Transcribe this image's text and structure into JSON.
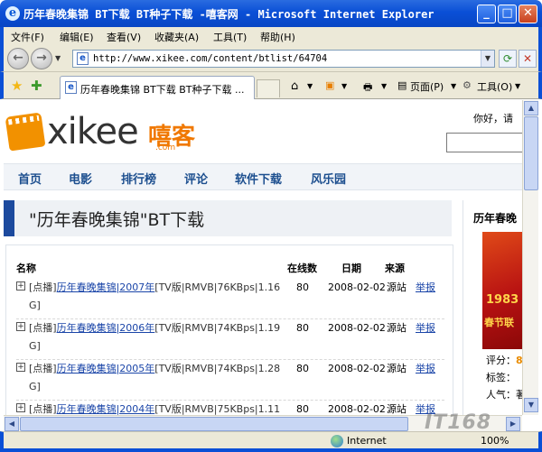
{
  "window": {
    "title": "历年春晚集锦 BT下载 BT种子下载 -嘻客网 - Microsoft Internet Explorer",
    "controls": [
      "_",
      "□",
      "✕"
    ]
  },
  "menu": [
    "文件(F)",
    "编辑(E)",
    "查看(V)",
    "收藏夹(A)",
    "工具(T)",
    "帮助(H)"
  ],
  "address": {
    "url": "http://www.xikee.com/content/btlist/64704"
  },
  "tab": {
    "label": "历年春晚集锦 BT下载 BT种子下载 ..."
  },
  "toolbar": {
    "page_label": "页面(P)",
    "tools_label": "工具(O)"
  },
  "site": {
    "logo_text": "xikee",
    "logo_cn": "嘻客",
    "logo_com": ".com",
    "greeting": "你好，请",
    "nav": [
      "首页",
      "电影",
      "排行榜",
      "评论",
      "软件下载",
      "风乐园"
    ]
  },
  "page": {
    "heading": "\"历年春晚集锦\"BT下载",
    "side_title": "历年春晚",
    "columns": {
      "name": "名称",
      "online": "在线数",
      "date": "日期",
      "source": "来源"
    },
    "rows": [
      {
        "tag": "[点播]",
        "link": "历年春晚集锦|2007年",
        "rest": "[TV版|RMVB|76KBps|1.16 G]",
        "online": "80",
        "date": "2008-02-02",
        "source": "源站",
        "report": "举报"
      },
      {
        "tag": "[点播]",
        "link": "历年春晚集锦|2006年",
        "rest": "[TV版|RMVB|74KBps|1.19 G]",
        "online": "80",
        "date": "2008-02-02",
        "source": "源站",
        "report": "举报"
      },
      {
        "tag": "[点播]",
        "link": "历年春晚集锦|2005年",
        "rest": "[TV版|RMVB|74KBps|1.28 G]",
        "online": "80",
        "date": "2008-02-02",
        "source": "源站",
        "report": "举报"
      },
      {
        "tag": "[点播]",
        "link": "历年春晚集锦|2004年",
        "rest": "[TV版|RMVB|75KBps|1.11",
        "online": "80",
        "date": "2008-02-02",
        "source": "源站",
        "report": "举报"
      }
    ],
    "poster": {
      "year": "1983",
      "text": "春节联"
    },
    "side_meta": [
      {
        "label": "评分：",
        "value": "8"
      },
      {
        "label": "标签：",
        "value": ""
      },
      {
        "label": "人气：",
        "value": "著"
      }
    ]
  },
  "status": {
    "zone": "Internet",
    "zoom": "100%"
  },
  "watermark": "IT168"
}
